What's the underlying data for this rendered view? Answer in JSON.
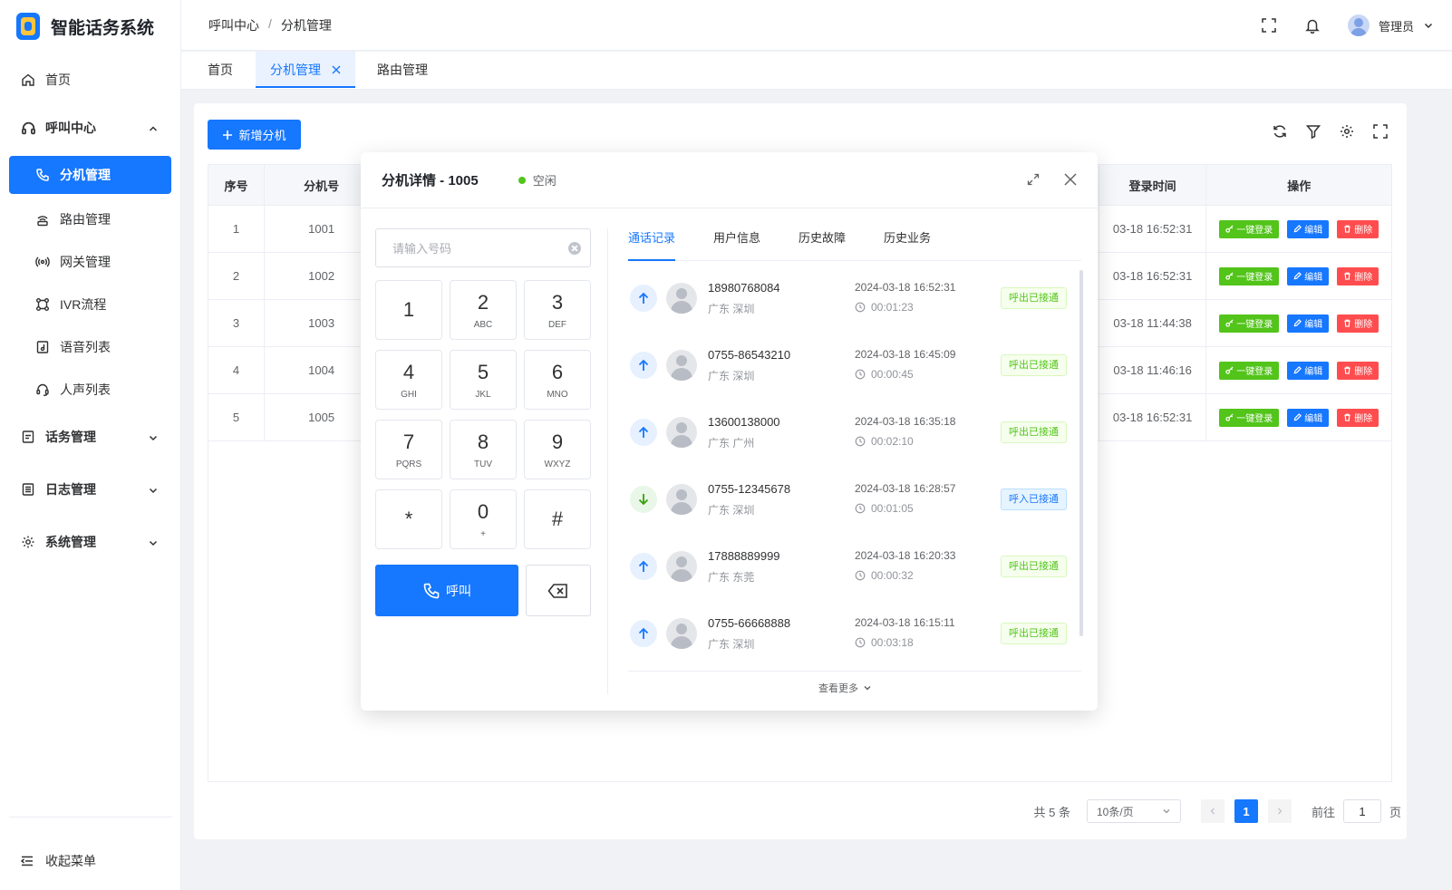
{
  "app": {
    "title": "智能话务系统"
  },
  "sidebar": {
    "home": "首页",
    "call_center": "呼叫中心",
    "call_center_items": [
      "分机管理",
      "路由管理",
      "网关管理",
      "IVR流程",
      "语音列表",
      "人声列表"
    ],
    "traffic": "话务管理",
    "logs": "日志管理",
    "system": "系统管理",
    "collapse": "收起菜单"
  },
  "header": {
    "breadcrumb": [
      "呼叫中心",
      "分机管理"
    ],
    "breadcrumb_sep": "/",
    "user": "管理员"
  },
  "tabs": {
    "home": "首页",
    "extension": "分机管理",
    "route": "路由管理"
  },
  "toolbar": {
    "add_label": "新增分机"
  },
  "table": {
    "headers": {
      "index": "序号",
      "extension": "分机号",
      "login_time": "登录时间",
      "ops": "操作"
    },
    "rows": [
      {
        "index": "1",
        "ext": "1001",
        "login": "03-18 16:52:31"
      },
      {
        "index": "2",
        "ext": "1002",
        "login": "03-18 16:52:31"
      },
      {
        "index": "3",
        "ext": "1003",
        "login": "03-18 11:44:38"
      },
      {
        "index": "4",
        "ext": "1004",
        "login": "03-18 11:46:16"
      },
      {
        "index": "5",
        "ext": "1005",
        "login": "03-18 16:52:31"
      }
    ],
    "op_login": "一键登录",
    "op_edit": "编辑",
    "op_delete": "删除"
  },
  "pager": {
    "total": "共 5 条",
    "page_size": "10条/页",
    "current": "1",
    "goto_label": "前往",
    "goto_value": "1",
    "page_suffix": "页"
  },
  "modal": {
    "title": "分机详情 - 1005",
    "status": "空闲",
    "status_color": "#52c41a",
    "input_placeholder": "请输入号码",
    "keys": [
      {
        "d": "1",
        "l": ""
      },
      {
        "d": "2",
        "l": "ABC"
      },
      {
        "d": "3",
        "l": "DEF"
      },
      {
        "d": "4",
        "l": "GHI"
      },
      {
        "d": "5",
        "l": "JKL"
      },
      {
        "d": "6",
        "l": "MNO"
      },
      {
        "d": "7",
        "l": "PQRS"
      },
      {
        "d": "8",
        "l": "TUV"
      },
      {
        "d": "9",
        "l": "WXYZ"
      },
      {
        "d": "*",
        "l": ""
      },
      {
        "d": "0",
        "l": "+"
      },
      {
        "d": "#",
        "l": ""
      }
    ],
    "call_label": "呼叫",
    "tabs": [
      "通话记录",
      "用户信息",
      "历史故障",
      "历史业务"
    ],
    "records": [
      {
        "dir": "out",
        "number": "18980768084",
        "location": "广东 深圳",
        "time": "2024-03-18 16:52:31",
        "duration": "00:01:23",
        "tag": "呼出已接通"
      },
      {
        "dir": "out",
        "number": "0755-86543210",
        "location": "广东 深圳",
        "time": "2024-03-18 16:45:09",
        "duration": "00:00:45",
        "tag": "呼出已接通"
      },
      {
        "dir": "out",
        "number": "13600138000",
        "location": "广东 广州",
        "time": "2024-03-18 16:35:18",
        "duration": "00:02:10",
        "tag": "呼出已接通"
      },
      {
        "dir": "in",
        "number": "0755-12345678",
        "location": "广东 深圳",
        "time": "2024-03-18 16:28:57",
        "duration": "00:01:05",
        "tag": "呼入已接通"
      },
      {
        "dir": "out",
        "number": "17888889999",
        "location": "广东 东莞",
        "time": "2024-03-18 16:20:33",
        "duration": "00:00:32",
        "tag": "呼出已接通"
      },
      {
        "dir": "out",
        "number": "0755-66668888",
        "location": "广东 深圳",
        "time": "2024-03-18 16:15:11",
        "duration": "00:03:18",
        "tag": "呼出已接通"
      }
    ],
    "more_label": "查看更多"
  },
  "colors": {
    "primary": "#1677ff",
    "success": "#52c41a",
    "danger": "#ff4d4f"
  }
}
